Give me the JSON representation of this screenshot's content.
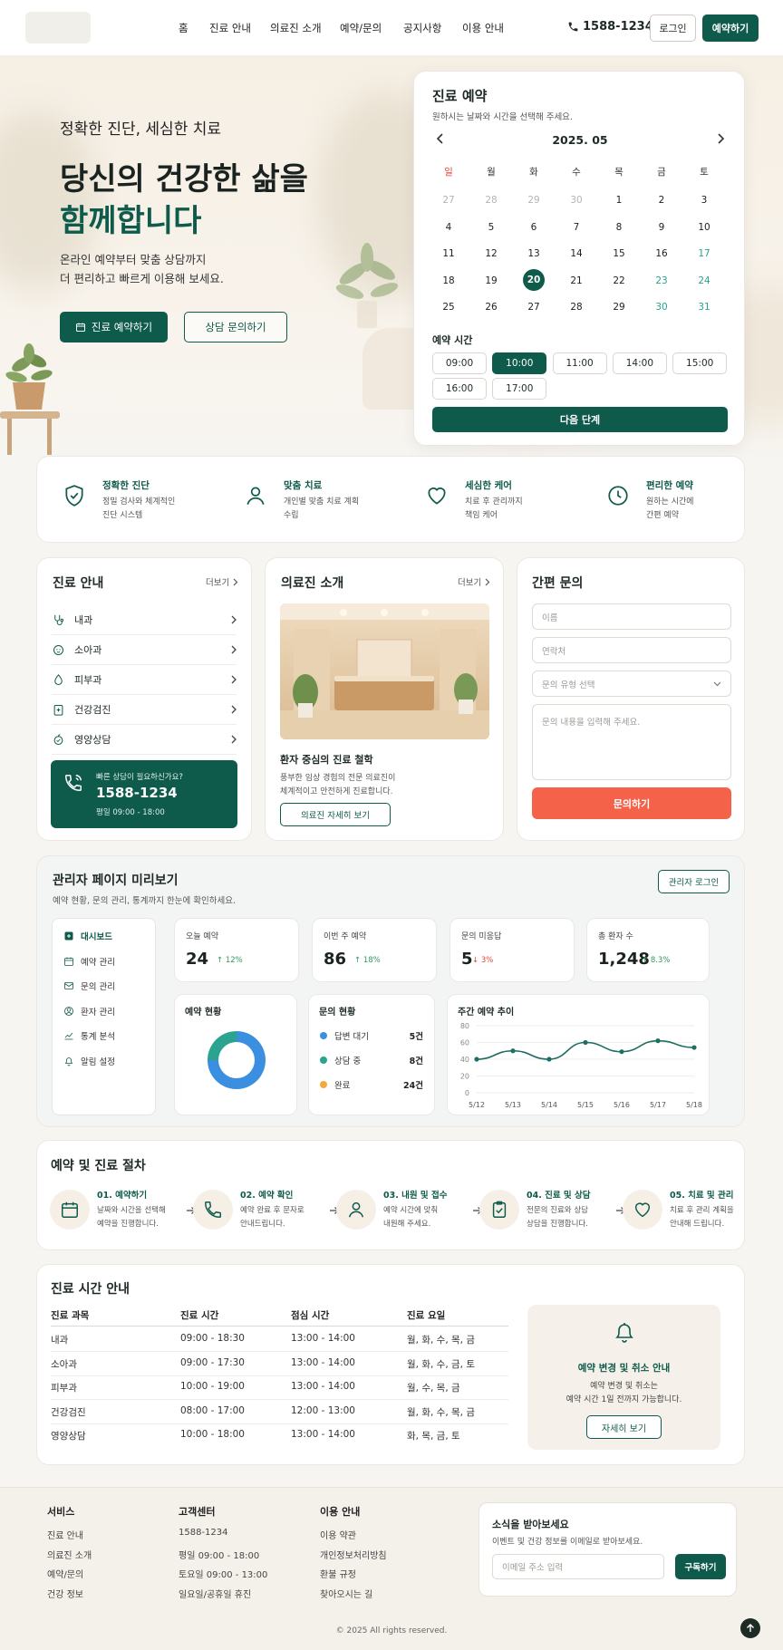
{
  "header": {
    "nav": [
      "홈",
      "진료 안내",
      "의료진 소개",
      "예약/문의",
      "공지사항",
      "이용 안내"
    ],
    "phone": "1588-1234",
    "login": "로그인",
    "reserve": "예약하기"
  },
  "hero": {
    "subtitle": "정확한 진단, 세심한 치료",
    "title_line1": "당신의 건강한 삶을",
    "title_line2": "함께합니다",
    "desc_line1": "온라인 예약부터 맞춤 상담까지",
    "desc_line2": "더 편리하고 빠르게 이용해 보세요.",
    "btn_primary": "진료 예약하기",
    "btn_secondary": "상담 문의하기"
  },
  "booking": {
    "title": "진료 예약",
    "subtitle": "원하시는 날짜와 시간을 선택해 주세요.",
    "month": "2025. 05",
    "weekdays": [
      "일",
      "월",
      "화",
      "수",
      "목",
      "금",
      "토"
    ],
    "days": [
      "27",
      "28",
      "29",
      "30",
      "1",
      "2",
      "3",
      "4",
      "5",
      "6",
      "7",
      "8",
      "9",
      "10",
      "11",
      "12",
      "13",
      "14",
      "15",
      "16",
      "17",
      "18",
      "19",
      "20",
      "21",
      "22",
      "23",
      "24",
      "25",
      "26",
      "27",
      "28",
      "29",
      "30",
      "31"
    ],
    "selected_day": "20",
    "time_label": "예약 시간",
    "times": [
      "09:00",
      "10:00",
      "11:00",
      "14:00",
      "15:00",
      "16:00",
      "17:00"
    ],
    "selected_time": "10:00",
    "next_btn": "다음 단계"
  },
  "features": [
    {
      "title": "정확한 진단",
      "line1": "정밀 검사와 체계적인",
      "line2": "진단 시스템",
      "icon": "shield-check-icon"
    },
    {
      "title": "맞춤 치료",
      "line1": "개인별 맞춤 치료 계획",
      "line2": "수립",
      "icon": "user-icon"
    },
    {
      "title": "세심한 케어",
      "line1": "치료 후 관리까지",
      "line2": "책임 케어",
      "icon": "heart-icon"
    },
    {
      "title": "편리한 예약",
      "line1": "원하는 시간에",
      "line2": "간편 예약",
      "icon": "clock-icon"
    }
  ],
  "departments": {
    "title": "진료 안내",
    "more": "더보기",
    "items": [
      "내과",
      "소아과",
      "피부과",
      "건강검진",
      "영양상담"
    ],
    "consult_q": "빠른 상담이 필요하신가요?",
    "consult_phone": "1588-1234",
    "consult_hours": "평일 09:00 - 18:00"
  },
  "doctors": {
    "title": "의료진 소개",
    "more": "더보기",
    "heading": "환자 중심의 진료 철학",
    "line1": "풍부한 임상 경험의 전문 의료진이",
    "line2": "체계적이고 안전하게 진료합니다.",
    "btn": "의료진 자세히 보기"
  },
  "inquiry": {
    "title": "간편 문의",
    "name_ph": "이름",
    "phone_ph": "연락처",
    "type_ph": "문의 유형 선택",
    "content_ph": "문의 내용을 입력해 주세요.",
    "submit": "문의하기"
  },
  "admin": {
    "title": "관리자 페이지 미리보기",
    "desc": "예약 현황, 문의 관리, 통계까지 한눈에 확인하세요.",
    "login_btn": "관리자 로그인",
    "menu": [
      "대시보드",
      "예약 관리",
      "문의 관리",
      "환자 관리",
      "통계 분석",
      "알림 설정"
    ],
    "stats": [
      {
        "label": "오늘 예약",
        "value": "24",
        "delta": "↑ 12%",
        "up": true
      },
      {
        "label": "이번 주 예약",
        "value": "86",
        "delta": "↑ 18%",
        "up": true
      },
      {
        "label": "문의 미응답",
        "value": "5",
        "delta": "↓ 3%",
        "up": false
      },
      {
        "label": "총 환자 수",
        "value": "1,248",
        "delta": "↑ 8.3%",
        "up": true
      }
    ],
    "reservation_status_title": "예약 현황",
    "inquiry_status_title": "문의 현황",
    "inquiry_status": [
      {
        "label": "답변 대기",
        "count": "5건",
        "color": "#3b8fe0"
      },
      {
        "label": "상담 중",
        "count": "8건",
        "color": "#2aa38f"
      },
      {
        "label": "완료",
        "count": "24건",
        "color": "#f4a93a"
      }
    ],
    "weekly_title": "주간 예약 추이"
  },
  "chart_data": [
    {
      "type": "pie",
      "title": "예약 현황",
      "categories": [
        "",
        ""
      ],
      "values": [
        75,
        25
      ],
      "colors": [
        "#3b8fe0",
        "#2aa38f"
      ]
    },
    {
      "type": "line",
      "title": "주간 예약 추이",
      "x": [
        "5/12",
        "5/13",
        "5/14",
        "5/15",
        "5/16",
        "5/17",
        "5/18"
      ],
      "series": [
        {
          "values": [
            40,
            50,
            40,
            60,
            49,
            62,
            54
          ]
        }
      ],
      "xi": [
        0,
        1,
        2,
        3,
        4,
        5,
        6
      ],
      "points_x": [
        0,
        0.5,
        1,
        1.5,
        2,
        2.5,
        3,
        3.5,
        4,
        4.5,
        5,
        5.5,
        6
      ],
      "points_y": [
        40,
        46,
        51,
        45,
        40,
        52,
        64,
        57,
        50,
        60,
        68,
        62,
        58,
        58,
        61
      ],
      "yticks": [
        0,
        20,
        40,
        60,
        80
      ],
      "ylim": [
        0,
        80
      ],
      "grid": true
    }
  ],
  "process": {
    "title": "예약 및 진료 절차",
    "steps": [
      {
        "title": "01. 예약하기",
        "line1": "날짜와 시간을 선택해",
        "line2": "예약을 진행합니다.",
        "icon": "calendar-icon"
      },
      {
        "title": "02. 예약 확인",
        "line1": "예약 완료 후 문자로",
        "line2": "안내드립니다.",
        "icon": "phone-icon"
      },
      {
        "title": "03. 내원 및 접수",
        "line1": "예약 시간에 맞춰",
        "line2": "내원해 주세요.",
        "icon": "user-icon"
      },
      {
        "title": "04. 진료 및 상담",
        "line1": "전문의 진료와 상담",
        "line2": "상담을 진행합니다.",
        "icon": "clipboard-icon"
      },
      {
        "title": "05. 치료 및 관리",
        "line1": "치료 후 관리 계획을",
        "line2": "안내해 드립니다.",
        "icon": "heart-icon"
      }
    ]
  },
  "hours": {
    "title": "진료 시간 안내",
    "headers": [
      "진료 과목",
      "진료 시간",
      "점심 시간",
      "진료 요일"
    ],
    "rows": [
      [
        "내과",
        "09:00 - 18:30",
        "13:00 - 14:00",
        "월, 화, 수, 목, 금"
      ],
      [
        "소아과",
        "09:00 - 17:30",
        "13:00 - 14:00",
        "월, 화, 수, 금, 토"
      ],
      [
        "피부과",
        "10:00 - 19:00",
        "13:00 - 14:00",
        "월, 수, 목, 금"
      ],
      [
        "건강검진",
        "08:00 - 17:00",
        "12:00 - 13:00",
        "월, 화, 수, 목, 금"
      ],
      [
        "영양상담",
        "10:00 - 18:00",
        "13:00 - 14:00",
        "화, 목, 금, 토"
      ]
    ],
    "notice_title": "예약 변경 및 취소 안내",
    "notice_line1": "예약 변경 및 취소는",
    "notice_line2": "예약 시간 1일 전까지 가능합니다.",
    "notice_btn": "자세히 보기"
  },
  "footer": {
    "cols": [
      {
        "title": "서비스",
        "items": [
          "진료 안내",
          "의료진 소개",
          "예약/문의",
          "건강 정보"
        ]
      },
      {
        "title": "고객센터",
        "items": [
          "1588-1234",
          "평일 09:00 - 18:00",
          "토요일 09:00 - 13:00",
          "일요일/공휴일 휴진"
        ]
      },
      {
        "title": "이용 안내",
        "items": [
          "이용 약관",
          "개인정보처리방침",
          "환불 규정",
          "찾아오시는 길"
        ]
      }
    ],
    "newsletter_title": "소식을 받아보세요",
    "newsletter_desc": "이벤트 및 건강 정보를 이메일로 받아보세요.",
    "email_ph": "이메일 주소 입력",
    "subscribe": "구독하기",
    "copyright": "© 2025 All rights reserved."
  }
}
